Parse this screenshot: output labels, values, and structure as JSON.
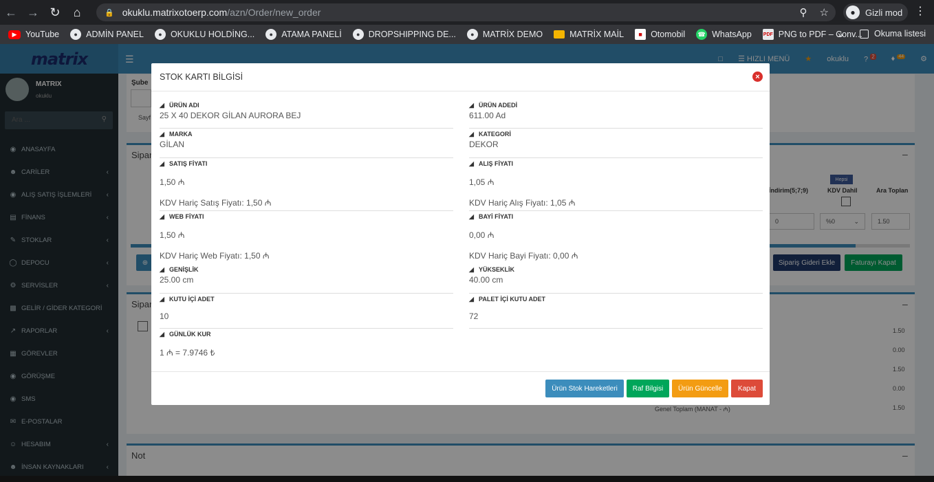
{
  "browser": {
    "url_host": "okuklu.matrixotoerp.com",
    "url_path": "/azn/Order/new_order",
    "incognito_label": "Gizli mod",
    "reading_list_label": "Okuma listesi",
    "more_bookmarks": "»",
    "bookmarks": [
      {
        "label": "YouTube",
        "icon": "youtube-icon"
      },
      {
        "label": "ADMİN PANEL",
        "icon": "globe-icon"
      },
      {
        "label": "OKUKLU HOLDİNG...",
        "icon": "globe-icon"
      },
      {
        "label": "ATAMA PANELİ",
        "icon": "globe-icon"
      },
      {
        "label": "DROPSHIPPING DE...",
        "icon": "globe-icon"
      },
      {
        "label": "MATRİX DEMO",
        "icon": "globe-icon"
      },
      {
        "label": "MATRİX MAİL",
        "icon": "mail-icon"
      },
      {
        "label": "Otomobil",
        "icon": "otomobil-icon"
      },
      {
        "label": "WhatsApp",
        "icon": "whatsapp-icon"
      },
      {
        "label": "PNG to PDF – Conv...",
        "icon": "png-pdf-icon"
      }
    ]
  },
  "header": {
    "logo_text": "matrix",
    "quick_menu": "HIZLI MENÜ",
    "user": "okuklu",
    "help_badge": "2",
    "notif_badge": "44"
  },
  "sidebar": {
    "user_name": "MATRIX",
    "user_sub": "okuklu",
    "search_placeholder": "Ara ...",
    "items": [
      {
        "label": "ANASAYFA",
        "icon": "dashboard-icon",
        "chev": false
      },
      {
        "label": "CARİLER",
        "icon": "users-icon",
        "chev": true
      },
      {
        "label": "ALIŞ SATIŞ İŞLEMLERİ",
        "icon": "eye-icon",
        "chev": true
      },
      {
        "label": "FİNANS",
        "icon": "money-icon",
        "chev": true
      },
      {
        "label": "STOKLAR",
        "icon": "edit-icon",
        "chev": true
      },
      {
        "label": "DEPOCU",
        "icon": "database-icon",
        "chev": true
      },
      {
        "label": "SERVİSLER",
        "icon": "cogs-icon",
        "chev": true
      },
      {
        "label": "GELİR / GİDER KATEGORİ",
        "icon": "file-icon",
        "chev": false
      },
      {
        "label": "RAPORLAR",
        "icon": "chart-icon",
        "chev": true
      },
      {
        "label": "GÖREVLER",
        "icon": "grid-icon",
        "chev": false
      },
      {
        "label": "GÖRÜŞME",
        "icon": "comment-icon",
        "chev": false
      },
      {
        "label": "SMS",
        "icon": "sms-icon",
        "chev": false
      },
      {
        "label": "E-POSTALAR",
        "icon": "envelope-icon",
        "chev": false
      },
      {
        "label": "HESABIM",
        "icon": "user-circle-icon",
        "chev": true
      },
      {
        "label": "İNSAN KAYNAKLARI",
        "icon": "people-icon",
        "chev": true
      }
    ]
  },
  "background": {
    "sube_label": "Şube",
    "sayf_label": "Sayf",
    "sipar1": "Sipar",
    "sipar2": "Sipar",
    "indirim_col": "İndirim(5;7;9)",
    "hepsi_badge": "Hepsi",
    "kdv_dahil_col": "KDV Dahil",
    "ara_toplam_col": "Ara Toplan",
    "discount_value": "0",
    "kdv_select": "%0",
    "ara_toplam_value": "1.50",
    "siparis_gideri_btn": "Sipariş Gideri Ekle",
    "faturayi_kapat_btn": "Faturayı Kapat",
    "totals": [
      "1.50",
      "0.00",
      "1.50",
      "0.00",
      "1.50"
    ],
    "genel_toplam": "Genel Toplam (MANAT - ₼)",
    "not_label": "Not",
    "progress_pct": 93
  },
  "modal": {
    "title": "STOK KARTI BİLGİSİ",
    "left": {
      "urun_adi_label": "ÜRÜN ADI",
      "urun_adi": "25 X 40 DEKOR GİLAN AURORA BEJ",
      "marka_label": "MARKA",
      "marka": "GİLAN",
      "satis_label": "SATIŞ FİYATI",
      "satis": "1,50 ₼",
      "satis_kdv": "KDV Hariç Satış Fiyatı: 1,50 ₼",
      "web_label": "WEB FİYATI",
      "web": "1,50 ₼",
      "web_kdv": "KDV Hariç Web Fiyatı: 1,50 ₼",
      "genislik_label": "GENİŞLİK",
      "genislik": "25.00 cm",
      "kutu_label": "KUTU İÇİ ADET",
      "kutu": "10",
      "kur_label": "GÜNLÜK KUR",
      "kur": "1 ₼ = 7.9746 ₺"
    },
    "right": {
      "adet_label": "ÜRÜN ADEDİ",
      "adet": "611.00 Ad",
      "kategori_label": "KATEGORİ",
      "kategori": "DEKOR",
      "alis_label": "ALIŞ FİYATI",
      "alis": "1,05 ₼",
      "alis_kdv": "KDV Hariç Alış Fiyatı: 1,05 ₼",
      "bayi_label": "BAYİ FİYATI",
      "bayi": "0,00 ₼",
      "bayi_kdv": "KDV Hariç Bayi Fiyatı: 0,00 ₼",
      "yukseklik_label": "YÜKSEKLİK",
      "yukseklik": "40.00 cm",
      "palet_label": "PALET İÇİ KUTU ADET",
      "palet": "72"
    },
    "buttons": {
      "stok_hareket": "Ürün Stok Hareketleri",
      "raf": "Raf Bilgisi",
      "guncelle": "Ürün Güncelle",
      "kapat": "Kapat"
    }
  },
  "colors": {
    "primary": "#3c8dbc",
    "success": "#00a65a",
    "warning": "#f39c12",
    "danger": "#dd4b39",
    "sidebar": "#222d32"
  }
}
